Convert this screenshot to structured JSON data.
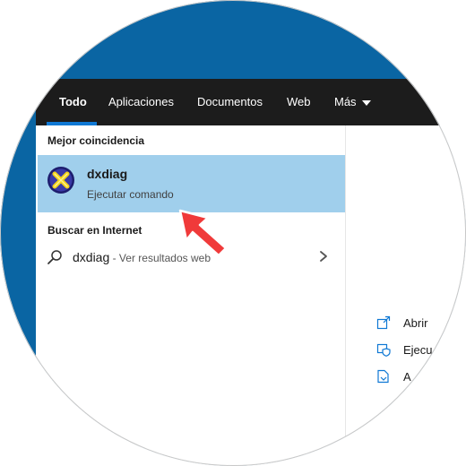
{
  "tabs": [
    {
      "label": "Todo",
      "active": true
    },
    {
      "label": "Aplicaciones"
    },
    {
      "label": "Documentos"
    },
    {
      "label": "Web"
    },
    {
      "label": "Más"
    }
  ],
  "best_match": {
    "heading": "Mejor coincidencia",
    "title": "dxdiag",
    "subtitle": "Ejecutar comando",
    "icon": "dxdiag-icon"
  },
  "web_search": {
    "heading": "Buscar en Internet",
    "term": "dxdiag",
    "suffix": " - Ver resultados web",
    "icon": "search-icon"
  },
  "actions": [
    {
      "label": "Abrir",
      "icon": "open-icon"
    },
    {
      "label": "Ejecu",
      "icon": "shield-icon"
    },
    {
      "label": "A",
      "icon": "file-location-icon"
    }
  ],
  "colors": {
    "desktop": "#0a65a3",
    "tabbar": "#1c1c1c",
    "accent": "#0f78d4",
    "highlight": "#a0cfec",
    "pointer_arrow": "#f03a3a"
  }
}
